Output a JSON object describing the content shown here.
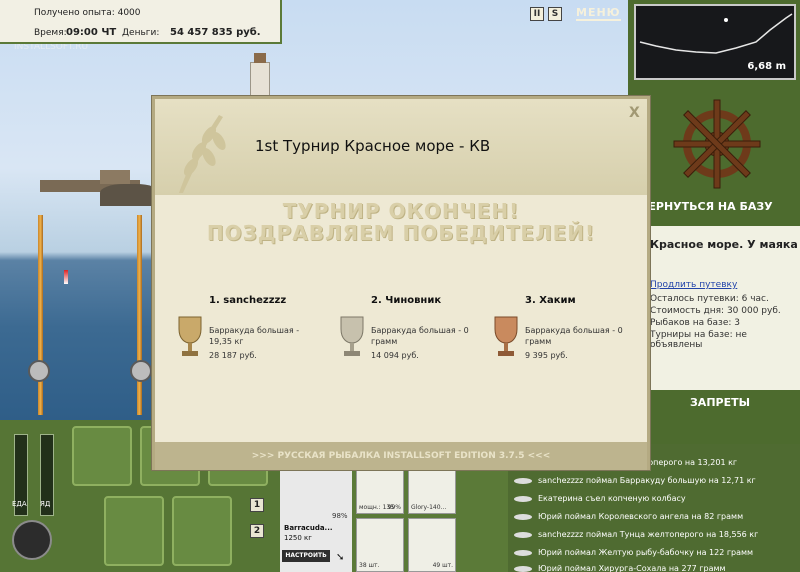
{
  "status": {
    "experience_label": "Получено опыта: 4000",
    "time_label": "Время:",
    "time_value": "09:00 ЧТ",
    "money_label": "Деньги:",
    "money_value": "54 457 835 руб."
  },
  "top_icons": {
    "pause_label": "II",
    "s_label": "S",
    "menu_label": "МЕНЮ"
  },
  "watermark": "INSTALLSOFT.RU",
  "depth": {
    "value": "6,68 m"
  },
  "right_panel": {
    "return_label": "ВЕРНУТЬСЯ НА БАЗУ",
    "location_title": "Красное море. У маяка",
    "extend_link": "Продлить путевку",
    "line1": "Осталось путевки: 6 час.",
    "line2": "Стоимость дня: 30 000 руб.",
    "line3": "Рыбаков на базе: 3",
    "line4": "Турниры на базе: не объявлены",
    "bans_label": "ЗАПРЕТЫ"
  },
  "log": [
    "Юрий поймал Тунца желтоперого на 13,201 кг",
    "sanchezzzz поймал Барракуду большую на 12,71 кг",
    "Екатерина съел копченую колбасу",
    "Юрий поймал Королевского ангела на 82 грамм",
    "sanchezzzz поймал Тунца желтоперого на 18,556 кг",
    "Юрий поймал Желтую рыбу-бабочку на 122 грамм",
    "Юрий поймал Хирурга-Сохала на 277 грамм"
  ],
  "bottom": {
    "food_label": "ЕДА",
    "poison_label": "ЯД",
    "page1": "1",
    "page2": "2"
  },
  "inventory": {
    "rod_percent": "98%",
    "rod_name": "Barracuda...",
    "rod_weight": "1250 кг",
    "setup_label": "НАСТРОИТЬ",
    "items": [
      {
        "caption": "мощн.: 135",
        "count": "99%"
      },
      {
        "caption": "Glory-140...",
        "count": ""
      },
      {
        "caption": "38 шт.",
        "count": ""
      },
      {
        "caption": "",
        "count": "49 шт."
      }
    ]
  },
  "dialog": {
    "title": "1st Турнир Красное море - КВ",
    "close": "X",
    "headline1": "ТУРНИР ОКОНЧЕН!",
    "headline2": "ПОЗДРАВЛЯЕМ ПОБЕДИТЕЛЕЙ!",
    "winners": [
      {
        "name": "1. sanchezzzz",
        "catch": "Барракуда большая - 19,35 кг",
        "money": "28 187 руб.",
        "cup_color": "#c9a96a"
      },
      {
        "name": "2. Чиновник",
        "catch": "Барракуда большая - 0 грамм",
        "money": "14 094 руб.",
        "cup_color": "#c7c1ad"
      },
      {
        "name": "3. Хаким",
        "catch": "Барракуда большая - 0 грамм",
        "money": "9 395 руб.",
        "cup_color": "#c98a5e"
      }
    ],
    "footer": ">>> РУССКАЯ РЫБАЛКА INSTALLSOFT EDITION 3.7.5 <<<"
  }
}
